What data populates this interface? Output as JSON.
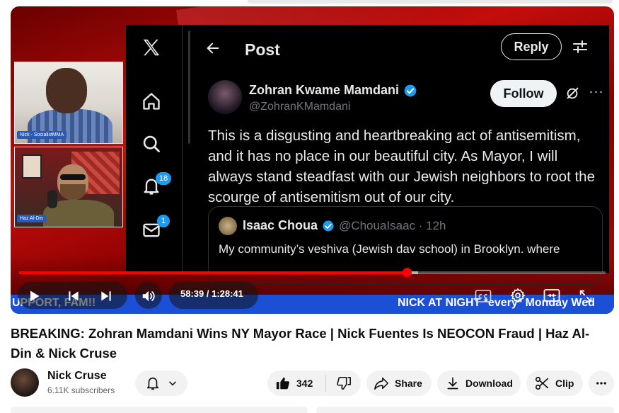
{
  "player": {
    "camera_labels": [
      "Nick - SocialistMMA",
      "Haz Al-Din"
    ],
    "x_post": {
      "header_title": "Post",
      "reply_label": "Reply",
      "notification_count": "18",
      "messages_count": "1",
      "author_name": "Zohran Kwame Mamdani",
      "author_handle": "@ZohranKMamdani",
      "follow_label": "Follow",
      "more_label": "···",
      "body": "This is a disgusting and heartbreaking act of antisemitism, and it has no place in our beautiful city. As Mayor, I will always stand steadfast with our Jewish neighbors to root the scourge of antisemitism out of our city.",
      "quote": {
        "author_name": "Isaac Choua",
        "author_handle": "@ChouaIsaac · 12h",
        "text": "My community’s veshiva (Jewish dav school) in Brooklyn. where"
      }
    },
    "progress": {
      "played_fraction": 0.661,
      "buffered_fraction": 0.68
    },
    "time_display": "58:39 / 1:28:41",
    "ticker": {
      "left": "UPPORT, FAM!!",
      "right": "NICK AT NIGHT *every* Monday Wed"
    },
    "accent_color": "#ff0000"
  },
  "video": {
    "title": "BREAKING: Zohran Mamdani Wins NY Mayor Race | Nick Fuentes Is NEOCON Fraud | Haz Al-Din & Nick Cruse"
  },
  "channel": {
    "name": "Nick Cruse",
    "subscribers": "6.11K subscribers"
  },
  "actions": {
    "like_count": "342",
    "share_label": "Share",
    "download_label": "Download",
    "clip_label": "Clip"
  }
}
